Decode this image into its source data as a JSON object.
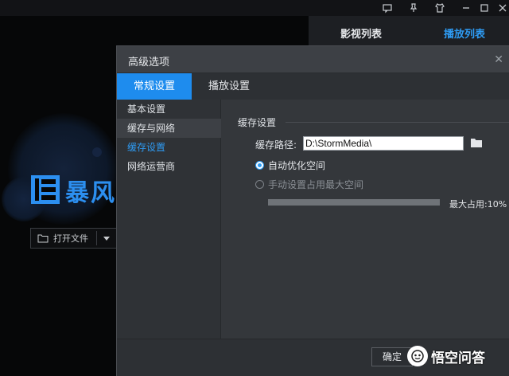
{
  "app": {
    "logo_text": "暴风",
    "open_file_label": "打开文件"
  },
  "playlist": {
    "tab_video": "影视列表",
    "tab_play": "播放列表"
  },
  "dialog": {
    "title": "高级选项",
    "tabs": [
      "常规设置",
      "播放设置"
    ],
    "sidebar": [
      "基本设置",
      "缓存与网络",
      "缓存设置",
      "网络运营商"
    ],
    "section_title": "缓存设置",
    "path_label": "缓存路径:",
    "path_value": "D:\\StormMedia\\",
    "radio_auto": "自动优化空间",
    "radio_manual": "手动设置占用最大空间",
    "max_label": "最大占用:10%",
    "max_percent": 10,
    "ok_label": "确定"
  },
  "watermark": {
    "text": "悟空问答"
  },
  "colors": {
    "accent": "#1e8cee",
    "link": "#2e9bf3"
  }
}
